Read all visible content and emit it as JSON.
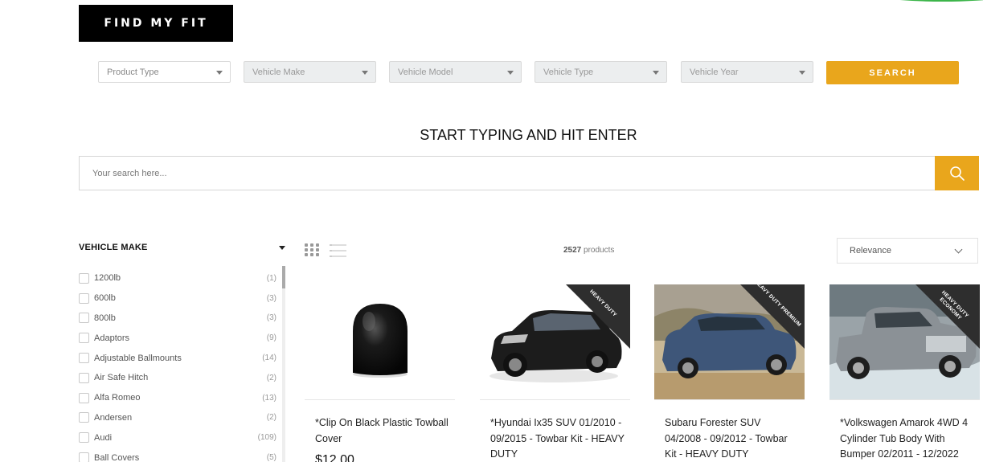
{
  "header": {
    "find_fit_label": "FIND MY FIT"
  },
  "selectors": [
    {
      "placeholder": "Product Type"
    },
    {
      "placeholder": "Vehicle Make"
    },
    {
      "placeholder": "Vehicle Model"
    },
    {
      "placeholder": "Vehicle Type"
    },
    {
      "placeholder": "Vehicle Year"
    }
  ],
  "search_button_label": "SEARCH",
  "search": {
    "title": "START TYPING AND HIT ENTER",
    "placeholder": "Your search here..."
  },
  "filters": {
    "heading": "VEHICLE MAKE",
    "items": [
      {
        "label": "1200lb",
        "count": "(1)"
      },
      {
        "label": "600lb",
        "count": "(3)"
      },
      {
        "label": "800lb",
        "count": "(3)"
      },
      {
        "label": "Adaptors",
        "count": "(9)"
      },
      {
        "label": "Adjustable Ballmounts",
        "count": "(14)"
      },
      {
        "label": "Air Safe Hitch",
        "count": "(2)"
      },
      {
        "label": "Alfa Romeo",
        "count": "(13)"
      },
      {
        "label": "Andersen",
        "count": "(2)"
      },
      {
        "label": "Audi",
        "count": "(109)"
      },
      {
        "label": "Ball Covers",
        "count": "(5)"
      }
    ]
  },
  "toolbar": {
    "count_number": "2527",
    "count_suffix": " products",
    "sort_value": "Relevance"
  },
  "products": [
    {
      "name": "*Clip On Black Plastic Towball Cover",
      "price": "$12.00",
      "ribbon": ""
    },
    {
      "name": "*Hyundai Ix35 SUV 01/2010 - 09/2015 - Towbar Kit - HEAVY DUTY",
      "price": "",
      "ribbon": "HEAVY DUTY"
    },
    {
      "name": "Subaru Forester SUV 04/2008 - 09/2012 - Towbar Kit - HEAVY DUTY",
      "price": "",
      "ribbon": "HEAVY DUTY PREMIUM"
    },
    {
      "name": "*Volkswagen Amarok 4WD 4 Cylinder Tub Body With Bumper 02/2011 - 12/2022",
      "price": "",
      "ribbon": "HEAVY DUTY ECONOMY"
    }
  ],
  "colors": {
    "accent": "#e9a61c",
    "dark": "#000000",
    "ribbon": "#2e2e2e"
  }
}
